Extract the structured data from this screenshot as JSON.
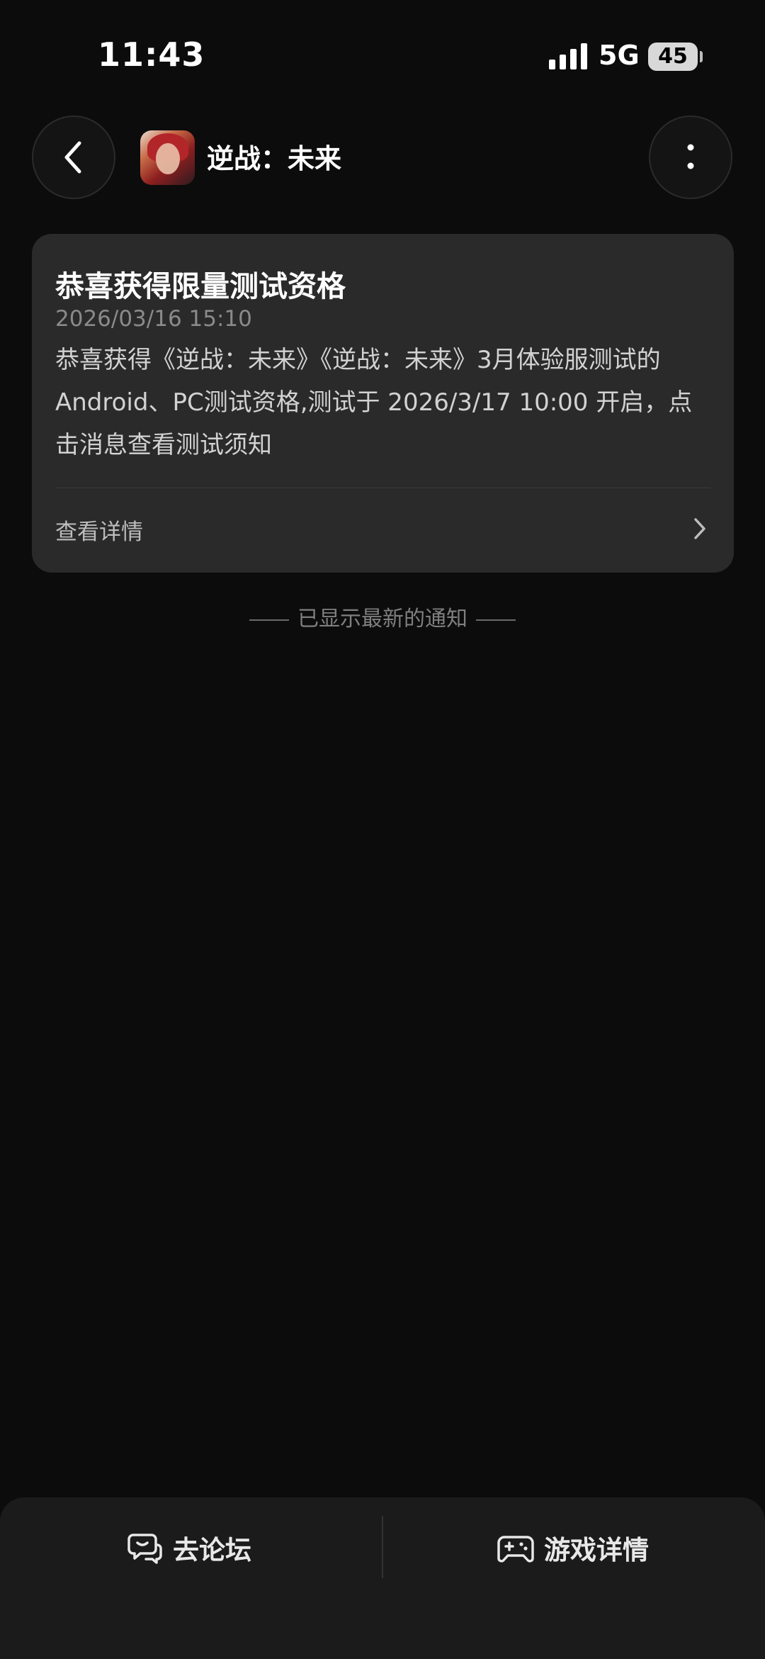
{
  "status_bar": {
    "time": "11:43",
    "network": "5G",
    "battery": "45"
  },
  "header": {
    "app_name": "逆战：未来"
  },
  "notification": {
    "title": "恭喜获得限量测试资格",
    "timestamp": "2026/03/16 15:10",
    "body": "恭喜获得《逆战：未来》《逆战：未来》3月体验服测试的Android、PC测试资格,测试于 2026/3/17 10:00 开启，点击消息查看测试须知",
    "link_label": "查看详情"
  },
  "end_note": "已显示最新的通知",
  "bottom_bar": {
    "forum_label": "去论坛",
    "game_detail_label": "游戏详情"
  },
  "icons": [
    "back-icon",
    "more-vertical-icon",
    "chevron-right-icon",
    "forum-chat-icon",
    "gamepad-icon"
  ]
}
